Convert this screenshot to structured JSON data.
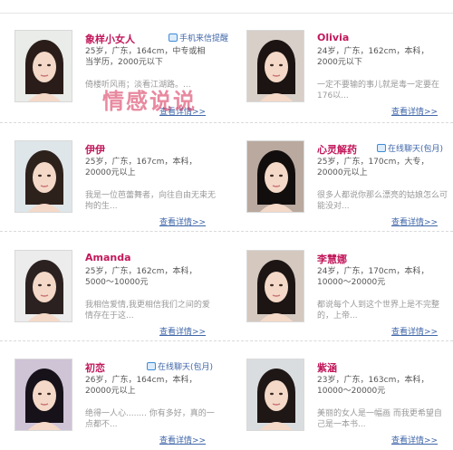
{
  "watermark": "情感说说",
  "profiles": [
    {
      "name": "象样小女人",
      "badge": "手机来信提醒",
      "info": "25岁，广东，164cm，中专或相当学历，2000元以下",
      "desc": "倚楼听风雨；淡看江湖路。...",
      "more": "查看详情>>",
      "hair": "#2a1d19",
      "bg": "#e9ece8"
    },
    {
      "name": "Olivia",
      "badge": "",
      "info": "24岁，广东，162cm，本科，2000元以下",
      "desc": "一定不要输的事儿就是毒一定要在176以...",
      "more": "查看详情>>",
      "hair": "#1b1412",
      "bg": "#d8cfc8"
    },
    {
      "name": "伊伊",
      "badge": "",
      "info": "25岁，广东，167cm，本科，20000元以上",
      "desc": "我是一位芭蕾舞者，向往自由无束无拘的生...",
      "more": "查看详情>>",
      "hair": "#2d211c",
      "bg": "#dfe6e9"
    },
    {
      "name": "心灵解药",
      "badge": "在线聊天(包月)",
      "info": "25岁，广东，170cm，大专，20000元以上",
      "desc": "很多人都说你那么漂亮的姑娘怎么可能没对...",
      "more": "查看详情>>",
      "hair": "#120e0d",
      "bg": "#b9a99f"
    },
    {
      "name": "Amanda",
      "badge": "",
      "info": "25岁，广东，162cm，本科，5000～10000元",
      "desc": "我相信爱情,我更相信我们之间的爱情存在于这...",
      "more": "查看详情>>",
      "hair": "#2b2120",
      "bg": "#ececec"
    },
    {
      "name": "李慧娜",
      "badge": "",
      "info": "24岁，广东，170cm，本科，10000～20000元",
      "desc": "都说每个人到这个世界上是不完整的，上帝...",
      "more": "查看详情>>",
      "hair": "#1c1514",
      "bg": "#d4c8bf"
    },
    {
      "name": "初恋",
      "badge": "在线聊天(包月)",
      "info": "26岁，广东，164cm，本科，20000元以上",
      "desc": "绝得一人心........ 你有多好，真的一点都不...",
      "more": "查看详情>>",
      "hair": "#17121a",
      "bg": "#cfc3d6"
    },
    {
      "name": "紫涵",
      "badge": "",
      "info": "23岁，广东，163cm，本科，10000～20000元",
      "desc": "美丽的女人是一幅画 而我更希望自己是一本书...",
      "more": "查看详情>>",
      "hair": "#1f1716",
      "bg": "#d9dde0"
    }
  ]
}
